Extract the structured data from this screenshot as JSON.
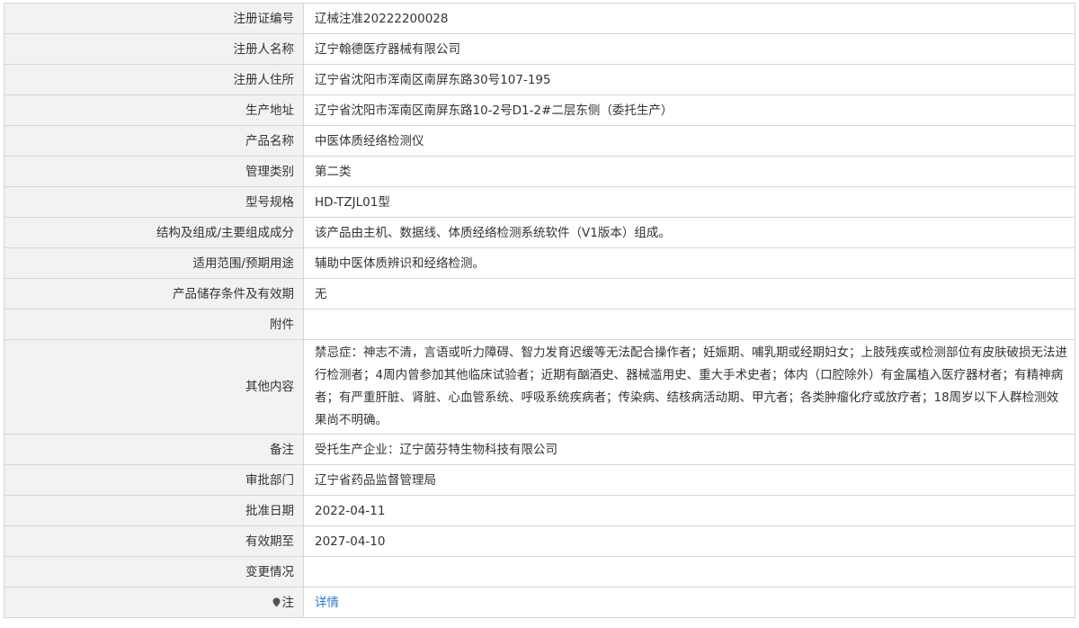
{
  "rows": [
    {
      "label": "注册证编号",
      "value": "辽械注准20222200028"
    },
    {
      "label": "注册人名称",
      "value": "辽宁翰德医疗器械有限公司"
    },
    {
      "label": "注册人住所",
      "value": "辽宁省沈阳市浑南区南屏东路30号107-195"
    },
    {
      "label": "生产地址",
      "value": "辽宁省沈阳市浑南区南屏东路10-2号D1-2#二层东侧（委托生产）"
    },
    {
      "label": "产品名称",
      "value": "中医体质经络检测仪"
    },
    {
      "label": "管理类别",
      "value": "第二类"
    },
    {
      "label": "型号规格",
      "value": "HD-TZJL01型"
    },
    {
      "label": "结构及组成/主要组成成分",
      "value": "该产品由主机、数据线、体质经络检测系统软件（V1版本）组成。"
    },
    {
      "label": "适用范围/预期用途",
      "value": "辅助中医体质辨识和经络检测。"
    },
    {
      "label": "产品储存条件及有效期",
      "value": "无"
    },
    {
      "label": "附件",
      "value": ""
    },
    {
      "label": "其他内容",
      "value": "禁忌症：神志不清，言语或听力障碍、智力发育迟缓等无法配合操作者；妊娠期、哺乳期或经期妇女；上肢残疾或检测部位有皮肤破损无法进行检测者；4周内曾参加其他临床试验者；近期有酗酒史、器械滥用史、重大手术史者；体内（口腔除外）有金属植入医疗器材者；有精神病者；有严重肝脏、肾脏、心血管系统、呼吸系统疾病者；传染病、结核病活动期、甲亢者；各类肿瘤化疗或放疗者；18周岁以下人群检测效果尚不明确。"
    },
    {
      "label": "备注",
      "value": "受托生产企业：辽宁茵芬特生物科技有限公司"
    },
    {
      "label": "审批部门",
      "value": "辽宁省药品监督管理局"
    },
    {
      "label": "批准日期",
      "value": "2022-04-11"
    },
    {
      "label": "有效期至",
      "value": "2027-04-10"
    },
    {
      "label": "变更情况",
      "value": ""
    }
  ],
  "note": {
    "label": "注",
    "icon": "pin-icon",
    "link_text": "详情",
    "link_color": "#2b7bd1"
  }
}
